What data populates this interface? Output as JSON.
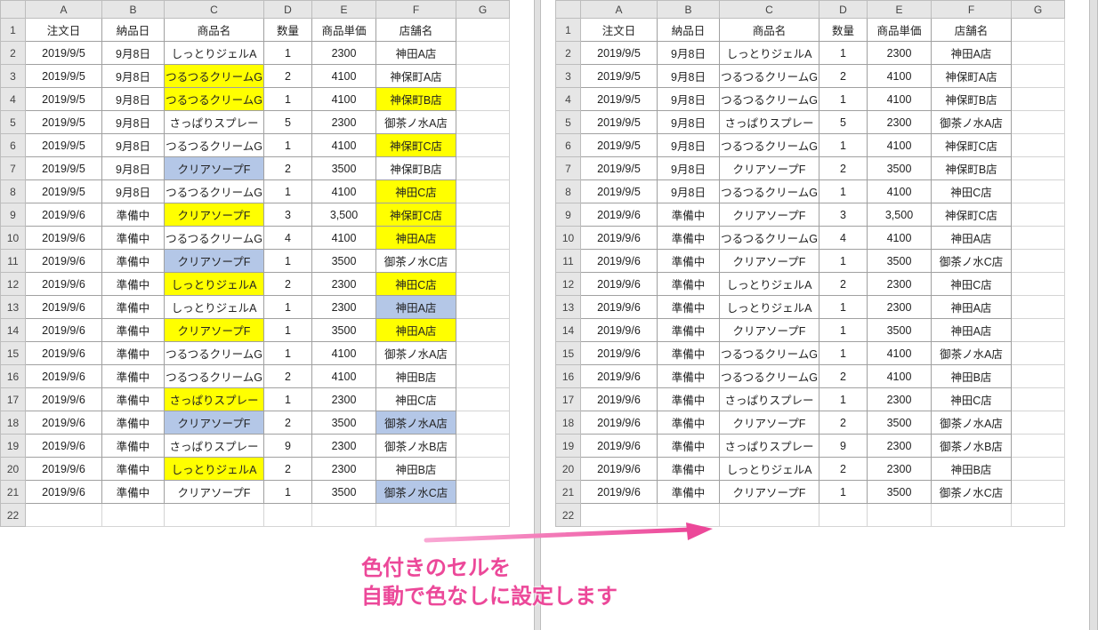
{
  "columns": [
    "A",
    "B",
    "C",
    "D",
    "E",
    "F",
    "G"
  ],
  "headers": {
    "A": "注文日",
    "B": "納品日",
    "C": "商品名",
    "D": "数量",
    "E": "商品単価",
    "F": "店舗名"
  },
  "rows": [
    {
      "A": "2019/9/5",
      "B": "9月8日",
      "C": "しっとりジェルA",
      "D": "1",
      "E": "2300",
      "F": "神田A店"
    },
    {
      "A": "2019/9/5",
      "B": "9月8日",
      "C": "つるつるクリームG",
      "D": "2",
      "E": "4100",
      "F": "神保町A店"
    },
    {
      "A": "2019/9/5",
      "B": "9月8日",
      "C": "つるつるクリームG",
      "D": "1",
      "E": "4100",
      "F": "神保町B店"
    },
    {
      "A": "2019/9/5",
      "B": "9月8日",
      "C": "さっぱりスプレー",
      "D": "5",
      "E": "2300",
      "F": "御茶ノ水A店"
    },
    {
      "A": "2019/9/5",
      "B": "9月8日",
      "C": "つるつるクリームG",
      "D": "1",
      "E": "4100",
      "F": "神保町C店"
    },
    {
      "A": "2019/9/5",
      "B": "9月8日",
      "C": "クリアソープF",
      "D": "2",
      "E": "3500",
      "F": "神保町B店"
    },
    {
      "A": "2019/9/5",
      "B": "9月8日",
      "C": "つるつるクリームG",
      "D": "1",
      "E": "4100",
      "F": "神田C店"
    },
    {
      "A": "2019/9/6",
      "B": "準備中",
      "C": "クリアソープF",
      "D": "3",
      "E": "3,500",
      "F": "神保町C店"
    },
    {
      "A": "2019/9/6",
      "B": "準備中",
      "C": "つるつるクリームG",
      "D": "4",
      "E": "4100",
      "F": "神田A店"
    },
    {
      "A": "2019/9/6",
      "B": "準備中",
      "C": "クリアソープF",
      "D": "1",
      "E": "3500",
      "F": "御茶ノ水C店"
    },
    {
      "A": "2019/9/6",
      "B": "準備中",
      "C": "しっとりジェルA",
      "D": "2",
      "E": "2300",
      "F": "神田C店"
    },
    {
      "A": "2019/9/6",
      "B": "準備中",
      "C": "しっとりジェルA",
      "D": "1",
      "E": "2300",
      "F": "神田A店"
    },
    {
      "A": "2019/9/6",
      "B": "準備中",
      "C": "クリアソープF",
      "D": "1",
      "E": "3500",
      "F": "神田A店"
    },
    {
      "A": "2019/9/6",
      "B": "準備中",
      "C": "つるつるクリームG",
      "D": "1",
      "E": "4100",
      "F": "御茶ノ水A店"
    },
    {
      "A": "2019/9/6",
      "B": "準備中",
      "C": "つるつるクリームG",
      "D": "2",
      "E": "4100",
      "F": "神田B店"
    },
    {
      "A": "2019/9/6",
      "B": "準備中",
      "C": "さっぱりスプレー",
      "D": "1",
      "E": "2300",
      "F": "神田C店"
    },
    {
      "A": "2019/9/6",
      "B": "準備中",
      "C": "クリアソープF",
      "D": "2",
      "E": "3500",
      "F": "御茶ノ水A店"
    },
    {
      "A": "2019/9/6",
      "B": "準備中",
      "C": "さっぱりスプレー",
      "D": "9",
      "E": "2300",
      "F": "御茶ノ水B店"
    },
    {
      "A": "2019/9/6",
      "B": "準備中",
      "C": "しっとりジェルA",
      "D": "2",
      "E": "2300",
      "F": "神田B店"
    },
    {
      "A": "2019/9/6",
      "B": "準備中",
      "C": "クリアソープF",
      "D": "1",
      "E": "3500",
      "F": "御茶ノ水C店"
    }
  ],
  "left_highlight": {
    "yellow": {
      "C": [
        3,
        4,
        9,
        12,
        14,
        17,
        20
      ],
      "F": [
        4,
        6,
        8,
        9,
        10,
        12,
        14
      ]
    },
    "blue": {
      "C": [
        7,
        11,
        18
      ],
      "F": [
        13,
        18,
        21
      ]
    }
  },
  "caption_line1": "色付きのセルを",
  "caption_line2": "自動で色なしに設定します"
}
